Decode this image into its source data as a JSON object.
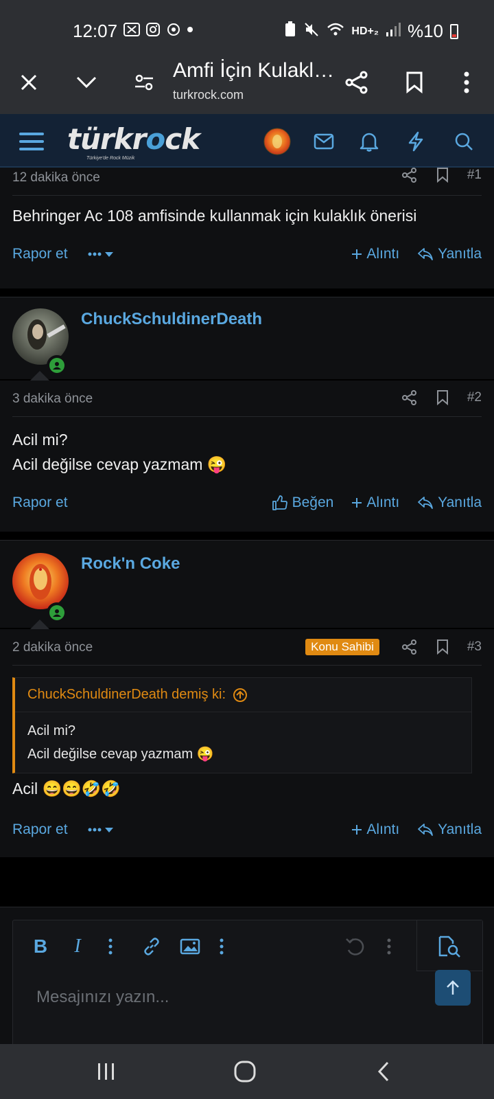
{
  "status_bar": {
    "time": "12:07",
    "network": "HD+₂",
    "battery": "%10"
  },
  "browser": {
    "title": "Amfi İçin Kulakl…",
    "url": "turkrock.com"
  },
  "site": {
    "logo_left": "türkr",
    "logo_accent": "o",
    "logo_right": "ck",
    "tagline": "Türkiye'de Rock Müzik"
  },
  "posts": [
    {
      "time": "12 dakika önce",
      "number": "#1",
      "lines": [
        "Behringer Ac 108 amfisinde kullanmak için kulaklık önerisi"
      ],
      "report": "Rapor et",
      "quote": "Alıntı",
      "reply": "Yanıtla"
    },
    {
      "username": "ChuckSchuldinerDeath",
      "time": "3 dakika önce",
      "number": "#2",
      "lines": [
        "Acil mi?",
        "Acil değilse cevap yazmam 😜"
      ],
      "report": "Rapor et",
      "like": "Beğen",
      "quote": "Alıntı",
      "reply": "Yanıtla"
    },
    {
      "username": "Rock'n Coke",
      "time": "2 dakika önce",
      "badge": "Konu Sahibi",
      "number": "#3",
      "quote_author": "ChuckSchuldinerDeath demiş ki:",
      "quote_lines": [
        "Acil mi?",
        "Acil değilse cevap yazmam 😜"
      ],
      "lines": [
        "Acil 😄😄🤣🤣"
      ],
      "report": "Rapor et",
      "quote": "Alıntı",
      "reply": "Yanıtla"
    }
  ],
  "editor": {
    "bold": "B",
    "italic": "I",
    "placeholder": "Mesajınızı yazın..."
  },
  "colors": {
    "accent": "#5aa8e0",
    "owner_badge": "#e08a12",
    "online": "#2e9e3a"
  }
}
